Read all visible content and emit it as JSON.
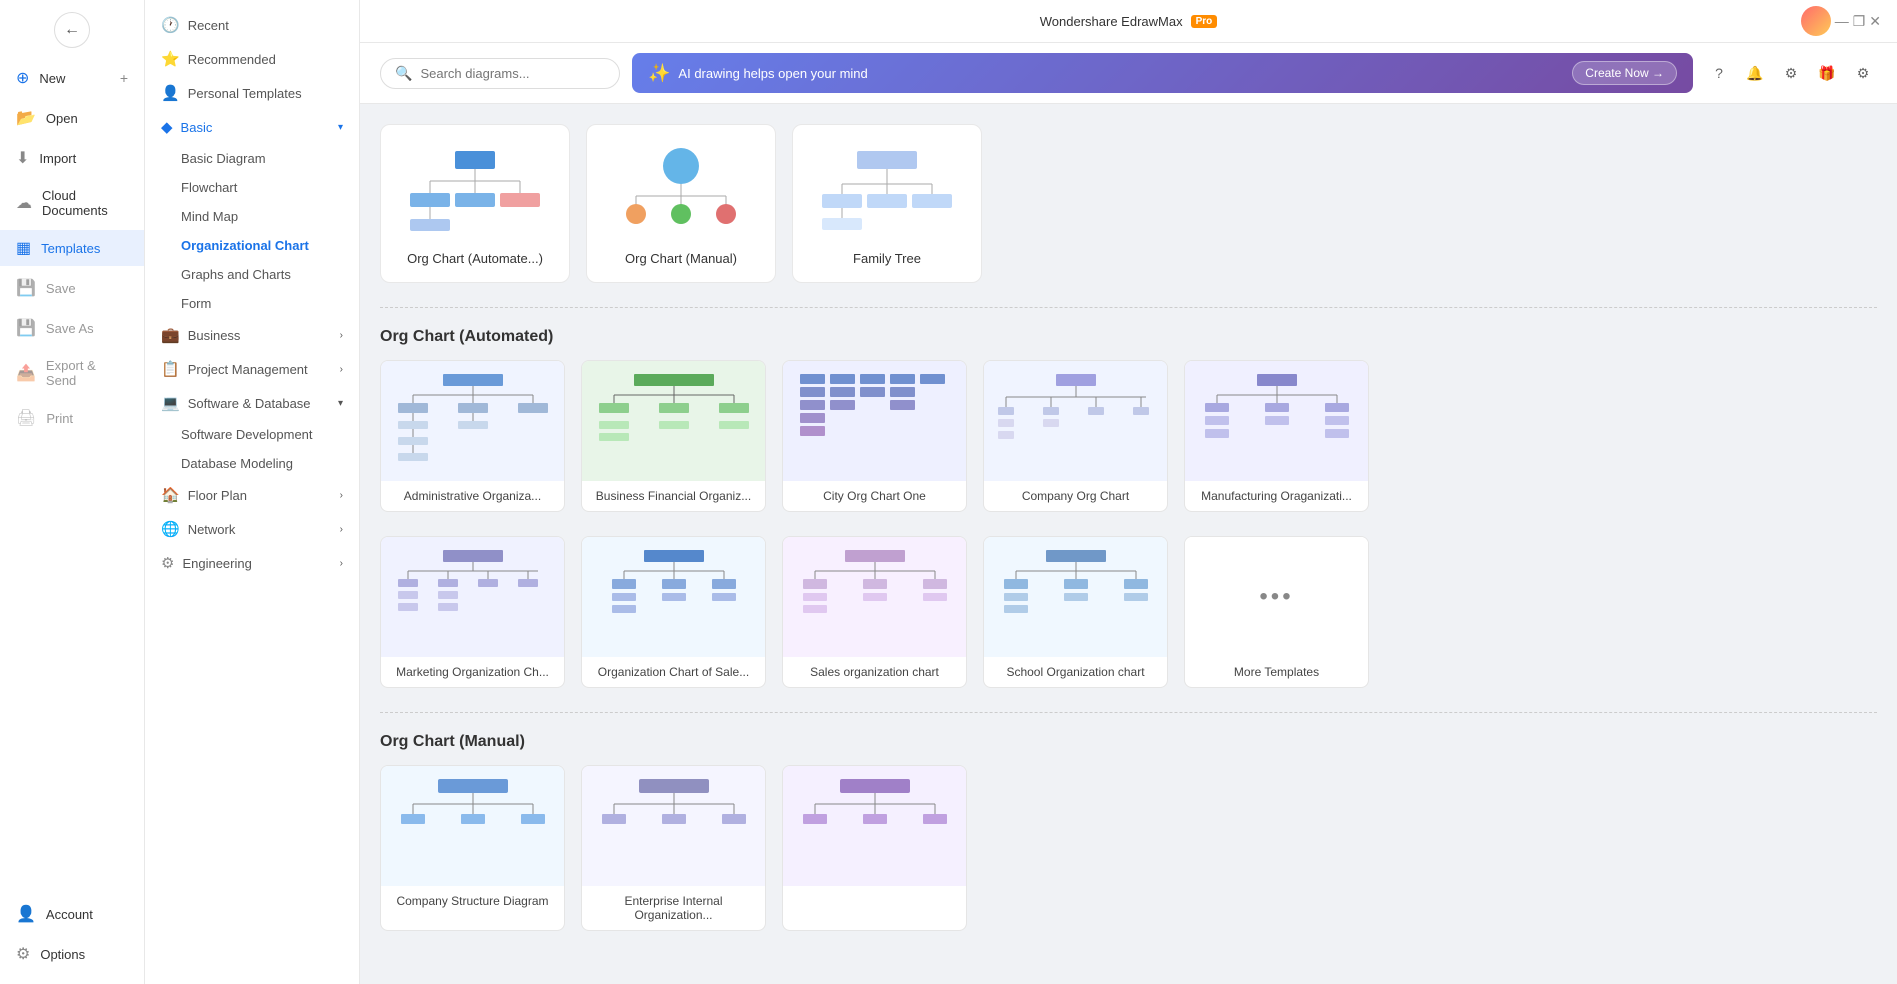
{
  "app": {
    "title": "Wondershare EdrawMax",
    "pro_badge": "Pro"
  },
  "window_controls": {
    "minimize": "—",
    "maximize": "❐",
    "close": "✕"
  },
  "nav_rail": {
    "back_icon": "←",
    "items": [
      {
        "id": "new",
        "label": "New",
        "icon": "⊕"
      },
      {
        "id": "open",
        "label": "Open",
        "icon": "📂"
      },
      {
        "id": "import",
        "label": "Import",
        "icon": "⬇"
      },
      {
        "id": "cloud",
        "label": "Cloud Documents",
        "icon": "☁"
      },
      {
        "id": "templates",
        "label": "Templates",
        "icon": "▦",
        "active": true
      },
      {
        "id": "save",
        "label": "Save",
        "icon": "💾"
      },
      {
        "id": "saveas",
        "label": "Save As",
        "icon": "💾"
      },
      {
        "id": "export",
        "label": "Export & Send",
        "icon": "📤"
      },
      {
        "id": "print",
        "label": "Print",
        "icon": "🖨"
      }
    ],
    "bottom_items": [
      {
        "id": "account",
        "label": "Account",
        "icon": "👤"
      },
      {
        "id": "options",
        "label": "Options",
        "icon": "⚙"
      }
    ]
  },
  "sidebar": {
    "sections": [
      {
        "id": "recent",
        "label": "Recent",
        "icon": "🕐",
        "expandable": false
      },
      {
        "id": "recommended",
        "label": "Recommended",
        "icon": "⭐",
        "expandable": false
      },
      {
        "id": "personal",
        "label": "Personal Templates",
        "icon": "👤",
        "expandable": false
      },
      {
        "id": "basic",
        "label": "Basic",
        "icon": "◆",
        "expandable": true,
        "expanded": true,
        "sub_items": [
          {
            "id": "basic-diagram",
            "label": "Basic Diagram"
          },
          {
            "id": "flowchart",
            "label": "Flowchart"
          },
          {
            "id": "mind-map",
            "label": "Mind Map"
          },
          {
            "id": "org-chart",
            "label": "Organizational Chart",
            "active": true
          }
        ]
      },
      {
        "id": "graphs",
        "label": "Graphs and Charts",
        "icon": "",
        "sub": true
      },
      {
        "id": "form",
        "label": "Form",
        "icon": "",
        "sub": true
      },
      {
        "id": "business",
        "label": "Business",
        "icon": "💼",
        "expandable": true
      },
      {
        "id": "project",
        "label": "Project Management",
        "icon": "📋",
        "expandable": true
      },
      {
        "id": "software",
        "label": "Software & Database",
        "icon": "💻",
        "expandable": true,
        "expanded": true,
        "sub_items": [
          {
            "id": "software-dev",
            "label": "Software Development"
          },
          {
            "id": "db-modeling",
            "label": "Database Modeling"
          }
        ]
      },
      {
        "id": "floor-plan",
        "label": "Floor Plan",
        "icon": "🏠",
        "expandable": true
      },
      {
        "id": "network",
        "label": "Network",
        "icon": "🌐",
        "expandable": true
      },
      {
        "id": "engineering",
        "label": "Engineering",
        "icon": "⚙",
        "expandable": true
      }
    ]
  },
  "search": {
    "placeholder": "Search diagrams..."
  },
  "ai_banner": {
    "icon": "✨",
    "text": "AI drawing helps open your mind",
    "button_label": "Create Now →"
  },
  "top_bar_icons": [
    "?",
    "🔔",
    "⚙",
    "🎁",
    "⚙"
  ],
  "top_cards": [
    {
      "id": "org-auto",
      "label": "Org Chart (Automate...)"
    },
    {
      "id": "org-manual",
      "label": "Org Chart (Manual)"
    },
    {
      "id": "family-tree",
      "label": "Family Tree"
    }
  ],
  "sections": [
    {
      "id": "org-automated",
      "title": "Org Chart (Automated)",
      "templates": [
        {
          "id": "admin-org",
          "label": "Administrative Organiza..."
        },
        {
          "id": "biz-fin",
          "label": "Business Financial Organiz..."
        },
        {
          "id": "city-org",
          "label": "City Org Chart One"
        },
        {
          "id": "company-org",
          "label": "Company Org Chart"
        },
        {
          "id": "manufacturing",
          "label": "Manufacturing Oraganizati..."
        },
        {
          "id": "marketing-org",
          "label": "Marketing Organization Ch..."
        },
        {
          "id": "org-sales",
          "label": "Organization Chart of Sale..."
        },
        {
          "id": "sales-org",
          "label": "Sales organization chart"
        },
        {
          "id": "school-org",
          "label": "School Organization chart"
        },
        {
          "id": "more-templates",
          "label": "More Templates",
          "is_more": true
        }
      ]
    },
    {
      "id": "org-manual",
      "title": "Org Chart (Manual)",
      "templates": [
        {
          "id": "manual-1",
          "label": "Company Structure Diagram"
        },
        {
          "id": "manual-2",
          "label": "Enterprise Internal Organization..."
        },
        {
          "id": "manual-3",
          "label": "..."
        }
      ]
    }
  ]
}
